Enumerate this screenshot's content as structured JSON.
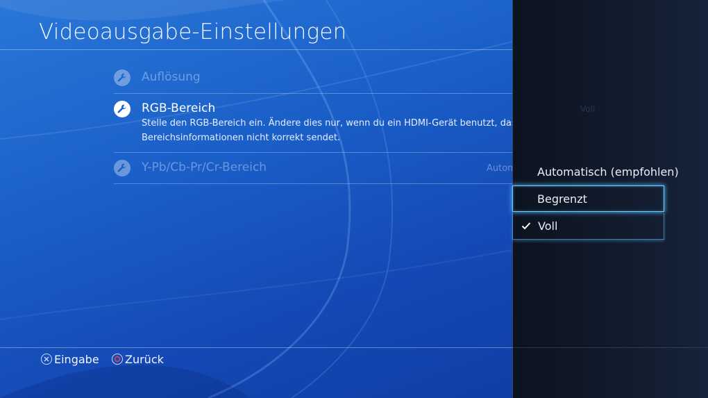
{
  "page": {
    "title": "Videoausgabe-Einstellungen"
  },
  "settings": [
    {
      "label": "Auflösung",
      "value": "",
      "icon": "wrench-icon",
      "dimmed": true
    },
    {
      "label": "RGB-Bereich",
      "value": "Voll",
      "icon": "wrench-icon",
      "dimmed": false,
      "description_line1": "Stelle den RGB-Bereich ein. Ändere dies nur, wenn du ein HDMI-Gerät benutzt, das die RG",
      "description_line2": "Bereichsinformationen nicht korrekt sendet."
    },
    {
      "label": "Y-Pb/Cb-Pr/Cr-Bereich",
      "value": "Autom",
      "icon": "wrench-icon",
      "dimmed": true
    }
  ],
  "dropdown": {
    "options": [
      {
        "label": "Automatisch (empfohlen)",
        "selected": false,
        "checked": false
      },
      {
        "label": "Begrenzt",
        "selected": true,
        "checked": false
      },
      {
        "label": "Voll",
        "selected": false,
        "checked": true
      }
    ]
  },
  "footer": {
    "enter": {
      "icon": "cross-button-icon",
      "label": "Eingabe"
    },
    "back": {
      "icon": "circle-button-icon",
      "label": "Zurück"
    }
  },
  "colors": {
    "background": "#1a5fc8",
    "panel": "#121b2c",
    "highlight": "#6ad1ff",
    "circle_button": "#e0405a"
  }
}
